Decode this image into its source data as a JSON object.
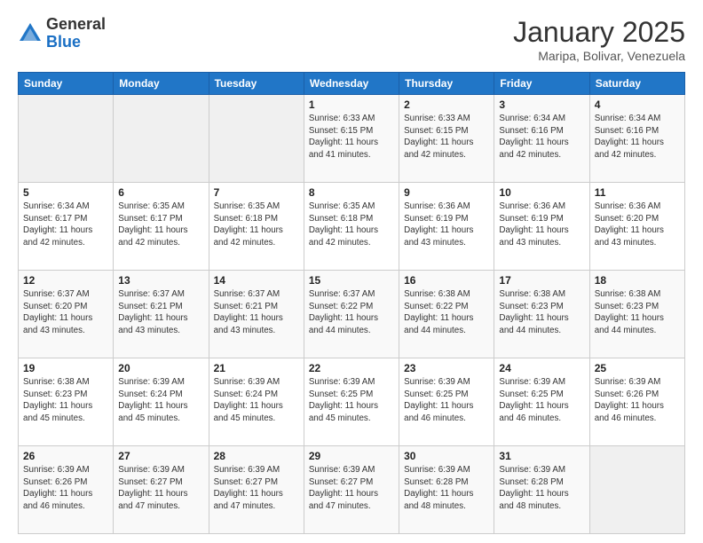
{
  "header": {
    "logo_general": "General",
    "logo_blue": "Blue",
    "title": "January 2025",
    "subtitle": "Maripa, Bolivar, Venezuela"
  },
  "days_of_week": [
    "Sunday",
    "Monday",
    "Tuesday",
    "Wednesday",
    "Thursday",
    "Friday",
    "Saturday"
  ],
  "weeks": [
    [
      {
        "day": "",
        "info": ""
      },
      {
        "day": "",
        "info": ""
      },
      {
        "day": "",
        "info": ""
      },
      {
        "day": "1",
        "info": "Sunrise: 6:33 AM\nSunset: 6:15 PM\nDaylight: 11 hours and 41 minutes."
      },
      {
        "day": "2",
        "info": "Sunrise: 6:33 AM\nSunset: 6:15 PM\nDaylight: 11 hours and 42 minutes."
      },
      {
        "day": "3",
        "info": "Sunrise: 6:34 AM\nSunset: 6:16 PM\nDaylight: 11 hours and 42 minutes."
      },
      {
        "day": "4",
        "info": "Sunrise: 6:34 AM\nSunset: 6:16 PM\nDaylight: 11 hours and 42 minutes."
      }
    ],
    [
      {
        "day": "5",
        "info": "Sunrise: 6:34 AM\nSunset: 6:17 PM\nDaylight: 11 hours and 42 minutes."
      },
      {
        "day": "6",
        "info": "Sunrise: 6:35 AM\nSunset: 6:17 PM\nDaylight: 11 hours and 42 minutes."
      },
      {
        "day": "7",
        "info": "Sunrise: 6:35 AM\nSunset: 6:18 PM\nDaylight: 11 hours and 42 minutes."
      },
      {
        "day": "8",
        "info": "Sunrise: 6:35 AM\nSunset: 6:18 PM\nDaylight: 11 hours and 42 minutes."
      },
      {
        "day": "9",
        "info": "Sunrise: 6:36 AM\nSunset: 6:19 PM\nDaylight: 11 hours and 43 minutes."
      },
      {
        "day": "10",
        "info": "Sunrise: 6:36 AM\nSunset: 6:19 PM\nDaylight: 11 hours and 43 minutes."
      },
      {
        "day": "11",
        "info": "Sunrise: 6:36 AM\nSunset: 6:20 PM\nDaylight: 11 hours and 43 minutes."
      }
    ],
    [
      {
        "day": "12",
        "info": "Sunrise: 6:37 AM\nSunset: 6:20 PM\nDaylight: 11 hours and 43 minutes."
      },
      {
        "day": "13",
        "info": "Sunrise: 6:37 AM\nSunset: 6:21 PM\nDaylight: 11 hours and 43 minutes."
      },
      {
        "day": "14",
        "info": "Sunrise: 6:37 AM\nSunset: 6:21 PM\nDaylight: 11 hours and 43 minutes."
      },
      {
        "day": "15",
        "info": "Sunrise: 6:37 AM\nSunset: 6:22 PM\nDaylight: 11 hours and 44 minutes."
      },
      {
        "day": "16",
        "info": "Sunrise: 6:38 AM\nSunset: 6:22 PM\nDaylight: 11 hours and 44 minutes."
      },
      {
        "day": "17",
        "info": "Sunrise: 6:38 AM\nSunset: 6:23 PM\nDaylight: 11 hours and 44 minutes."
      },
      {
        "day": "18",
        "info": "Sunrise: 6:38 AM\nSunset: 6:23 PM\nDaylight: 11 hours and 44 minutes."
      }
    ],
    [
      {
        "day": "19",
        "info": "Sunrise: 6:38 AM\nSunset: 6:23 PM\nDaylight: 11 hours and 45 minutes."
      },
      {
        "day": "20",
        "info": "Sunrise: 6:39 AM\nSunset: 6:24 PM\nDaylight: 11 hours and 45 minutes."
      },
      {
        "day": "21",
        "info": "Sunrise: 6:39 AM\nSunset: 6:24 PM\nDaylight: 11 hours and 45 minutes."
      },
      {
        "day": "22",
        "info": "Sunrise: 6:39 AM\nSunset: 6:25 PM\nDaylight: 11 hours and 45 minutes."
      },
      {
        "day": "23",
        "info": "Sunrise: 6:39 AM\nSunset: 6:25 PM\nDaylight: 11 hours and 46 minutes."
      },
      {
        "day": "24",
        "info": "Sunrise: 6:39 AM\nSunset: 6:25 PM\nDaylight: 11 hours and 46 minutes."
      },
      {
        "day": "25",
        "info": "Sunrise: 6:39 AM\nSunset: 6:26 PM\nDaylight: 11 hours and 46 minutes."
      }
    ],
    [
      {
        "day": "26",
        "info": "Sunrise: 6:39 AM\nSunset: 6:26 PM\nDaylight: 11 hours and 46 minutes."
      },
      {
        "day": "27",
        "info": "Sunrise: 6:39 AM\nSunset: 6:27 PM\nDaylight: 11 hours and 47 minutes."
      },
      {
        "day": "28",
        "info": "Sunrise: 6:39 AM\nSunset: 6:27 PM\nDaylight: 11 hours and 47 minutes."
      },
      {
        "day": "29",
        "info": "Sunrise: 6:39 AM\nSunset: 6:27 PM\nDaylight: 11 hours and 47 minutes."
      },
      {
        "day": "30",
        "info": "Sunrise: 6:39 AM\nSunset: 6:28 PM\nDaylight: 11 hours and 48 minutes."
      },
      {
        "day": "31",
        "info": "Sunrise: 6:39 AM\nSunset: 6:28 PM\nDaylight: 11 hours and 48 minutes."
      },
      {
        "day": "",
        "info": ""
      }
    ]
  ]
}
